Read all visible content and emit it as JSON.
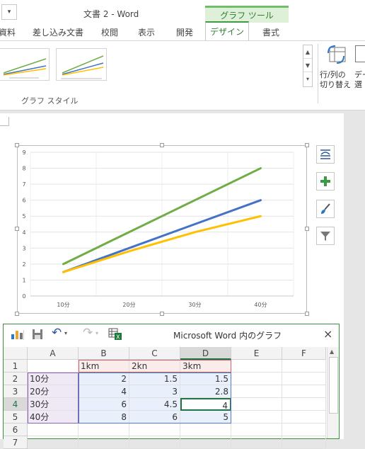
{
  "window": {
    "title": "文書 2 - Word",
    "qat_dropdown": "▾",
    "context_tab": "グラフ ツール"
  },
  "tabs": [
    "資料",
    "差し込み文書",
    "校閲",
    "表示",
    "開発",
    "デザイン",
    "書式"
  ],
  "ribbon": {
    "group_label": "グラフ スタイル",
    "switch_row_col_line1": "行/列の",
    "switch_row_col_line2": "切り替え",
    "select_data_line1": "デー",
    "select_data_line2": "選"
  },
  "chart_data": {
    "type": "line",
    "categories": [
      "10分",
      "20分",
      "30分",
      "40分"
    ],
    "series": [
      {
        "name": "1km",
        "values": [
          2,
          4,
          6,
          8
        ],
        "color": "#70ad47"
      },
      {
        "name": "2kn",
        "values": [
          1.5,
          3,
          4.5,
          6
        ],
        "color": "#4472c4"
      },
      {
        "name": "3km",
        "values": [
          1.5,
          2.8,
          4,
          5
        ],
        "color": "#ffc000"
      }
    ],
    "ylim": [
      0,
      9
    ],
    "yticks": [
      "0",
      "1",
      "2",
      "3",
      "4",
      "5",
      "6",
      "7",
      "8",
      "9"
    ],
    "grid": true,
    "legend": "none"
  },
  "data_window": {
    "title": "Microsoft Word 内のグラフ",
    "close": "×",
    "undo_icon": "↶",
    "redo_icon": "↷",
    "columns": [
      "A",
      "B",
      "C",
      "D",
      "E",
      "F"
    ],
    "rows": [
      {
        "n": "1",
        "cells": [
          "",
          "1km",
          "2kn",
          "3km",
          "",
          ""
        ]
      },
      {
        "n": "2",
        "cells": [
          "10分",
          "2",
          "1.5",
          "1.5",
          "",
          ""
        ]
      },
      {
        "n": "3",
        "cells": [
          "20分",
          "4",
          "3",
          "2.8",
          "",
          ""
        ]
      },
      {
        "n": "4",
        "cells": [
          "30分",
          "6",
          "4.5",
          "4",
          "",
          ""
        ]
      },
      {
        "n": "5",
        "cells": [
          "40分",
          "8",
          "6",
          "5",
          "",
          ""
        ]
      },
      {
        "n": "6",
        "cells": [
          "",
          "",
          "",
          "",
          "",
          ""
        ]
      },
      {
        "n": "7",
        "cells": [
          "",
          "",
          "",
          "",
          "",
          ""
        ]
      }
    ]
  }
}
